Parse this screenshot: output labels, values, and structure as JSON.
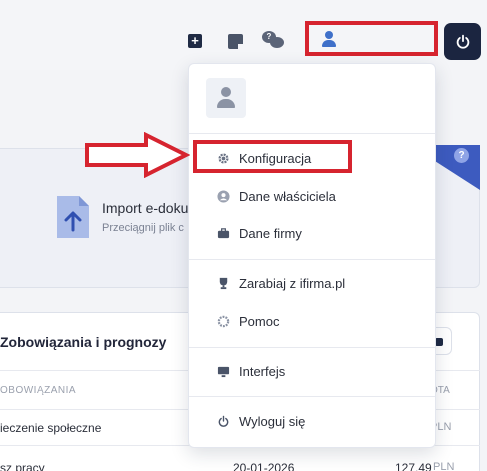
{
  "import_card": {
    "title": "Import e-doku",
    "subtitle": "Przeciągnij plik c",
    "help": "?"
  },
  "obligations": {
    "title": "Zobowiązania i prognozy",
    "col_left": "OBOWIĄZANIA",
    "col_right": "OTA",
    "rows": [
      {
        "name": "ieczenie społeczne",
        "date": "",
        "amount": "",
        "currency": "PLN"
      },
      {
        "name": "sz pracy",
        "date": "20-01-2026",
        "amount": "127,49",
        "currency": "PLN"
      }
    ]
  },
  "dropdown": {
    "items": [
      {
        "label": "Konfiguracja",
        "icon": "gear-icon"
      },
      {
        "label": "Dane właściciela",
        "icon": "user-circle-icon"
      },
      {
        "label": "Dane firmy",
        "icon": "briefcase-icon"
      },
      {
        "label": "Zarabiaj z ifirma.pl",
        "icon": "trophy-icon"
      },
      {
        "label": "Pomoc",
        "icon": "help-icon"
      },
      {
        "label": "Interfejs",
        "icon": "monitor-icon"
      },
      {
        "label": "Wyloguj się",
        "icon": "power-icon"
      }
    ]
  },
  "annotations": {
    "highlight_color": "#d6242f"
  },
  "colors": {
    "accent": "#3d5bbf",
    "dark": "#1b2540"
  }
}
